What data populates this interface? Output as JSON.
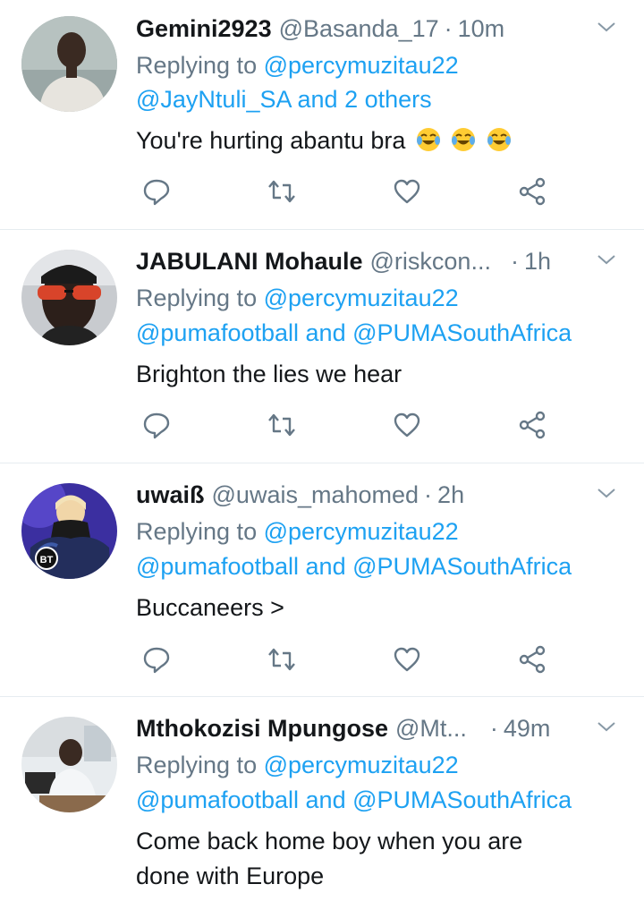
{
  "tweets": [
    {
      "name": "Gemini2923",
      "handle": "@Basanda_17",
      "time": "10m",
      "replying_prefix": "Replying to",
      "replying_first": "@percymuzitau22",
      "replying_line2_a": "@JayNtuli_SA",
      "replying_line2_and": "and",
      "replying_line2_b": "2 others",
      "text": "You're hurting abantu bra",
      "emoji": [
        "tears-of-joy-emoji",
        "tears-of-joy-emoji",
        "tears-of-joy-emoji"
      ]
    },
    {
      "name": "JABULANI Mohaule",
      "handle": "@riskcon...",
      "time": "1h",
      "replying_prefix": "Replying to",
      "replying_first": "@percymuzitau22",
      "replying_line2_a": "@pumafootball",
      "replying_line2_and": "and",
      "replying_line2_b": "@PUMASouthAfrica",
      "text": "Brighton the lies we hear"
    },
    {
      "name": "uwaiß",
      "handle": "@uwais_mahomed",
      "time": "2h",
      "replying_prefix": "Replying to",
      "replying_first": "@percymuzitau22",
      "replying_line2_a": "@pumafootball",
      "replying_line2_and": "and",
      "replying_line2_b": "@PUMASouthAfrica",
      "text": "Buccaneers >",
      "avatar_badge": "BT"
    },
    {
      "name": "Mthokozisi Mpungose",
      "handle": "@Mt...",
      "time": "49m",
      "replying_prefix": "Replying to",
      "replying_first": "@percymuzitau22",
      "replying_line2_a": "@pumafootball",
      "replying_line2_and": "and",
      "replying_line2_b": "@PUMASouthAfrica",
      "text": "Come back home boy when you are done with Europe"
    }
  ],
  "icons": [
    "reply-icon",
    "retweet-icon",
    "like-icon",
    "share-icon",
    "chevron-down-icon"
  ],
  "colors": {
    "link": "#1da1f2",
    "muted": "#657786",
    "text": "#14171a",
    "divider": "#e6ecf0"
  }
}
